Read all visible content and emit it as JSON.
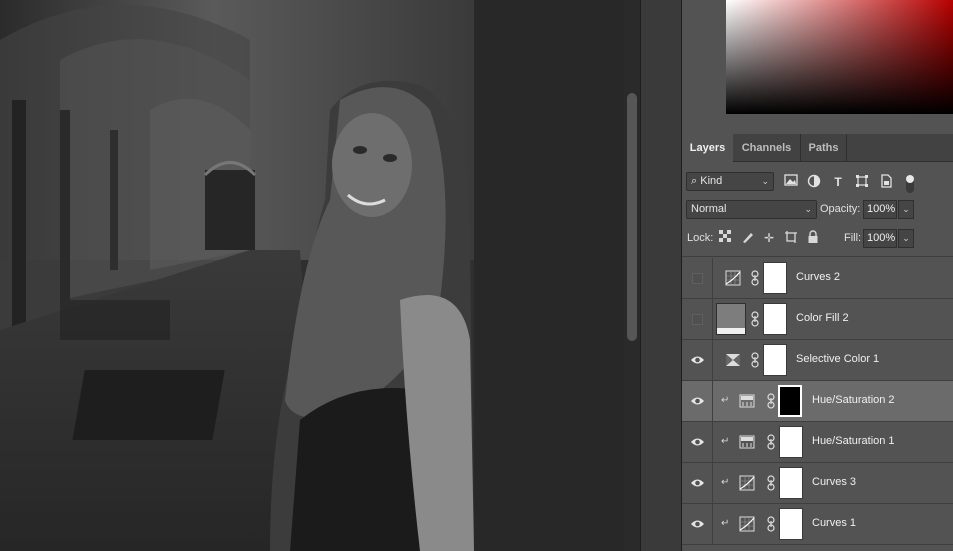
{
  "canvas": {
    "image_description_label": "Cloister corridor portrait"
  },
  "tabs": [
    {
      "label": "Layers",
      "active": true
    },
    {
      "label": "Channels",
      "active": false
    },
    {
      "label": "Paths",
      "active": false
    }
  ],
  "filter": {
    "kind_label": "Kind",
    "icons": [
      "image-filter-icon",
      "adjustment-filter-icon",
      "type-filter-icon",
      "shape-filter-icon",
      "smart-object-filter-icon",
      "filter-toggle-icon"
    ]
  },
  "blend": {
    "mode": "Normal",
    "opacity_label": "Opacity:",
    "opacity_value": "100%"
  },
  "lock": {
    "label": "Lock:",
    "fill_label": "Fill:",
    "fill_value": "100%"
  },
  "layers": [
    {
      "name": "Curves 2",
      "visible": false,
      "clipped": false,
      "kind": "curves",
      "selected": false
    },
    {
      "name": "Color Fill 2",
      "visible": false,
      "clipped": false,
      "kind": "color-fill",
      "selected": false
    },
    {
      "name": "Selective Color 1",
      "visible": true,
      "clipped": false,
      "kind": "selective-color",
      "selected": false
    },
    {
      "name": "Hue/Saturation 2",
      "visible": true,
      "clipped": true,
      "kind": "hue-saturation",
      "selected": true
    },
    {
      "name": "Hue/Saturation 1",
      "visible": true,
      "clipped": true,
      "kind": "hue-saturation",
      "selected": false
    },
    {
      "name": "Curves 3",
      "visible": true,
      "clipped": true,
      "kind": "curves",
      "selected": false
    },
    {
      "name": "Curves 1",
      "visible": true,
      "clipped": true,
      "kind": "curves",
      "selected": false
    }
  ],
  "colors": {
    "panel": "#535353",
    "selected_row": "#6b6b6b",
    "picker_hue": "#b80000"
  }
}
